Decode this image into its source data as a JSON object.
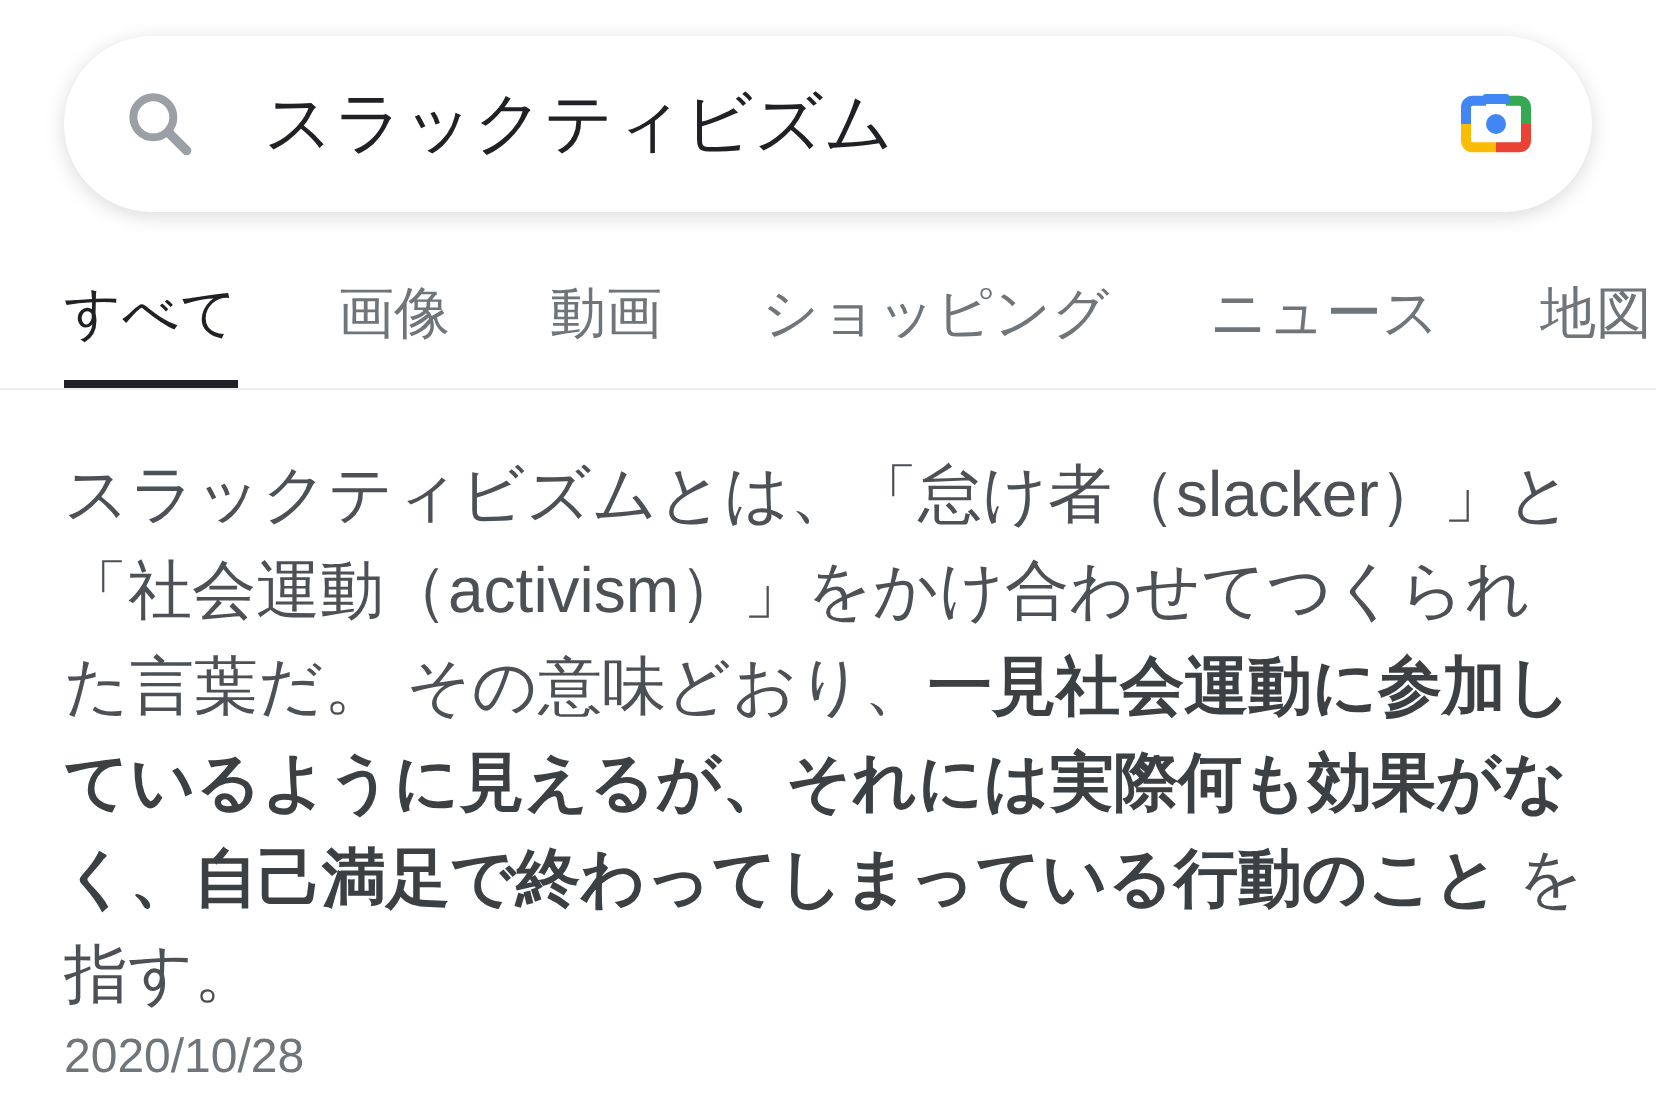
{
  "search": {
    "value": "スラックティビズム"
  },
  "tabs": [
    {
      "label": "すべて",
      "selected": true
    },
    {
      "label": "画像",
      "selected": false
    },
    {
      "label": "動画",
      "selected": false
    },
    {
      "label": "ショッピング",
      "selected": false
    },
    {
      "label": "ニュース",
      "selected": false
    },
    {
      "label": "地図",
      "selected": false
    }
  ],
  "snippet": {
    "text": "スラックティビズムとは、「怠け者（slacker）」と「社会運動（activism）」をかけ合わせてつくられた言葉だ。 その意味どおり、**一見社会運動に参加しているように見えるが、それには実際何も効果がなく、自己満足で終わってしまっている行動のこと** を指す。",
    "date": "2020/10/28"
  }
}
